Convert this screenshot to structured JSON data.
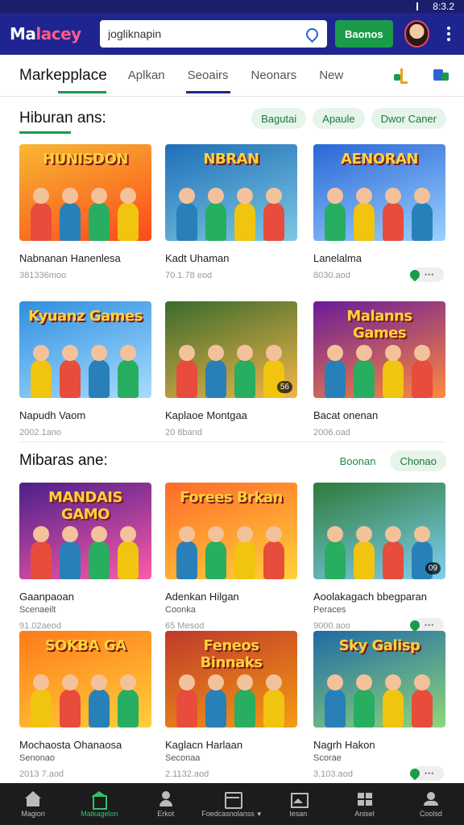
{
  "status": {
    "time": "8:3.2"
  },
  "header": {
    "logo_a": "Ma",
    "logo_b": "lacey",
    "search_value": "jogliknapin",
    "button_label": "Baonos"
  },
  "tabs": {
    "items": [
      "Markepplace",
      "Aplkan",
      "Seoairs",
      "Neonars",
      "New"
    ]
  },
  "section1": {
    "title": "Hiburan ans:",
    "chips": [
      "Bagutai",
      "Apaule",
      "Dwor Caner"
    ],
    "cards": [
      {
        "banner": "HUNISDON",
        "name": "Nabnanan Hanenlesa",
        "meta": "381336moo",
        "colors": [
          "#f7b733",
          "#fc4a1a"
        ]
      },
      {
        "banner": "NBRAN",
        "name": "Kadt Uhaman",
        "meta": "70.1.78 eod",
        "colors": [
          "#1e6fb8",
          "#7ec8e3"
        ]
      },
      {
        "banner": "AENORAN",
        "name": "Lanelalma",
        "meta": "8030.aod",
        "colors": [
          "#2a66d6",
          "#9ad1ff"
        ]
      },
      {
        "banner": "Kyuanz Games",
        "name": "Napudh Vaom",
        "meta": "2002.1ano",
        "colors": [
          "#2f8fe0",
          "#a8dcff"
        ]
      },
      {
        "banner": "",
        "name": "Kaplaoe Montgaa",
        "meta": "20 8band",
        "badge": "56",
        "colors": [
          "#3a6b2b",
          "#f2b54a"
        ]
      },
      {
        "banner": "Malanns Games",
        "name": "Bacat onenan",
        "meta": "2006.oad",
        "colors": [
          "#6a1b9a",
          "#ff8a3d"
        ]
      }
    ]
  },
  "section2": {
    "title": "Mibaras ane:",
    "link": "Boonan",
    "chip": "Chonao",
    "cards": [
      {
        "banner": "MANDAIS GAMO",
        "name": "Gaanpaoan",
        "sub": "Scenaeilt",
        "meta": "91.02aeod",
        "colors": [
          "#4a1f8a",
          "#ff5aa8"
        ]
      },
      {
        "banner": "Forees Brkan",
        "name": "Adenkan Hilgan",
        "sub": "Coonka",
        "meta": "65 Mesod",
        "colors": [
          "#ff6a2a",
          "#ffd23a"
        ]
      },
      {
        "banner": "",
        "name": "Aoolakagach bbegparan",
        "sub": "Peraces",
        "meta": "9000.aoo",
        "badge": "09",
        "colors": [
          "#2f7a3a",
          "#7ed0f0"
        ]
      },
      {
        "banner": "SOKBA GA",
        "name": "Mochaosta Ohanaosa",
        "sub": "Senonao",
        "meta": "2013 7.aod",
        "colors": [
          "#ff7a1a",
          "#ffcf3a"
        ]
      },
      {
        "banner": "Feneos Binnaks",
        "name": "Kaglacn Harlaan",
        "sub": "Seconaa",
        "meta": "2.1132.aod",
        "colors": [
          "#c0392b",
          "#f39c12"
        ]
      },
      {
        "banner": "Sky Galisp",
        "name": "Nagrh Hakon",
        "sub": "Scorae",
        "meta": "3.103.aod",
        "colors": [
          "#1f6aa5",
          "#8fd67a"
        ]
      }
    ]
  },
  "bottomnav": {
    "items": [
      "Magion",
      "Matkagelon",
      "Erkot",
      "Foedcasnolanss",
      "Iesan",
      "Anisel",
      "Coolsd"
    ]
  }
}
